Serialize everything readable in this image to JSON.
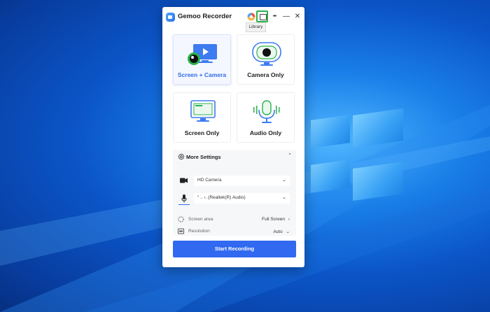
{
  "app": {
    "title": "Gemoo Recorder"
  },
  "titlebar": {
    "library_tooltip": "Library",
    "more_label": "•••",
    "minimize_label": "—",
    "close_label": "✕"
  },
  "modes": [
    {
      "label": "Screen + Camera",
      "icon": "screen-camera-icon",
      "selected": true
    },
    {
      "label": "Camera Only",
      "icon": "webcam-icon",
      "selected": false
    },
    {
      "label": "Screen Only",
      "icon": "monitor-icon",
      "selected": false
    },
    {
      "label": "Audio Only",
      "icon": "microphone-icon",
      "selected": false
    }
  ],
  "settings": {
    "title": "More Settings",
    "camera": {
      "value": "HD Camera"
    },
    "microphone": {
      "value": "“ ..  ‹. (Realtek(R) Audio)"
    },
    "screen_area": {
      "label": "Screen area",
      "value": "Full Screen"
    },
    "resolution": {
      "label": "Resolution",
      "value": "Auto"
    }
  },
  "start_button": {
    "label": "Start Recording"
  },
  "colors": {
    "accent": "#3169f0",
    "active_text": "#2f6be8",
    "highlight": "#2bb24c"
  }
}
